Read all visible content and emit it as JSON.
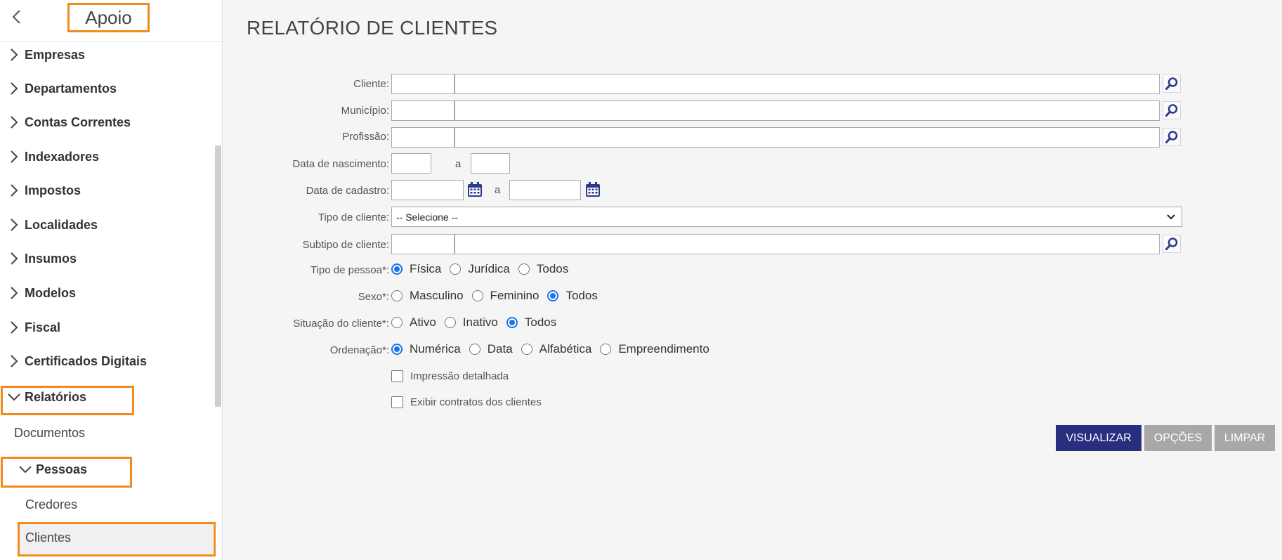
{
  "sidebar": {
    "title": "Apoio",
    "menu": [
      {
        "label": "Empresas",
        "expanded": false
      },
      {
        "label": "Departamentos",
        "expanded": false
      },
      {
        "label": "Contas Correntes",
        "expanded": false
      },
      {
        "label": "Indexadores",
        "expanded": false
      },
      {
        "label": "Impostos",
        "expanded": false
      },
      {
        "label": "Localidades",
        "expanded": false
      },
      {
        "label": "Insumos",
        "expanded": false
      },
      {
        "label": "Modelos",
        "expanded": false
      },
      {
        "label": "Fiscal",
        "expanded": false
      },
      {
        "label": "Certificados Digitais",
        "expanded": false
      },
      {
        "label": "Relatórios",
        "expanded": true
      }
    ],
    "reports": {
      "documentos": "Documentos",
      "pessoas": "Pessoas",
      "credores": "Credores",
      "clientes": "Clientes"
    }
  },
  "page": {
    "title": "RELATÓRIO DE CLIENTES"
  },
  "form": {
    "cliente_label": "Cliente:",
    "municipio_label": "Município:",
    "profissao_label": "Profissão:",
    "data_nascimento_label": "Data de nascimento:",
    "data_cadastro_label": "Data de cadastro:",
    "range_separator": "a",
    "tipo_cliente_label": "Tipo de cliente:",
    "tipo_cliente_selected": "-- Selecione --",
    "subtipo_label": "Subtipo de cliente:",
    "tipo_pessoa": {
      "label": "Tipo de pessoa*:",
      "options": [
        "Física",
        "Jurídica",
        "Todos"
      ],
      "selected": "Física"
    },
    "sexo": {
      "label": "Sexo*:",
      "options": [
        "Masculino",
        "Feminino",
        "Todos"
      ],
      "selected": "Todos"
    },
    "situacao": {
      "label": "Situação do cliente*:",
      "options": [
        "Ativo",
        "Inativo",
        "Todos"
      ],
      "selected": "Todos"
    },
    "ordenacao": {
      "label": "Ordenação*:",
      "options": [
        "Numérica",
        "Data",
        "Alfabética",
        "Empreendimento"
      ],
      "selected": "Numérica"
    },
    "impressao_detalhada": "Impressão detalhada",
    "exibir_contratos": "Exibir contratos dos clientes"
  },
  "buttons": {
    "visualizar": "VISUALIZAR",
    "opcoes": "OPÇÕES",
    "limpar": "LIMPAR"
  },
  "colors": {
    "highlight": "#f28a1c",
    "primary": "#2a2e7e",
    "disabled": "#a8a8a8",
    "radio_selected": "#1a73e8",
    "icon": "#2d3a8c"
  }
}
